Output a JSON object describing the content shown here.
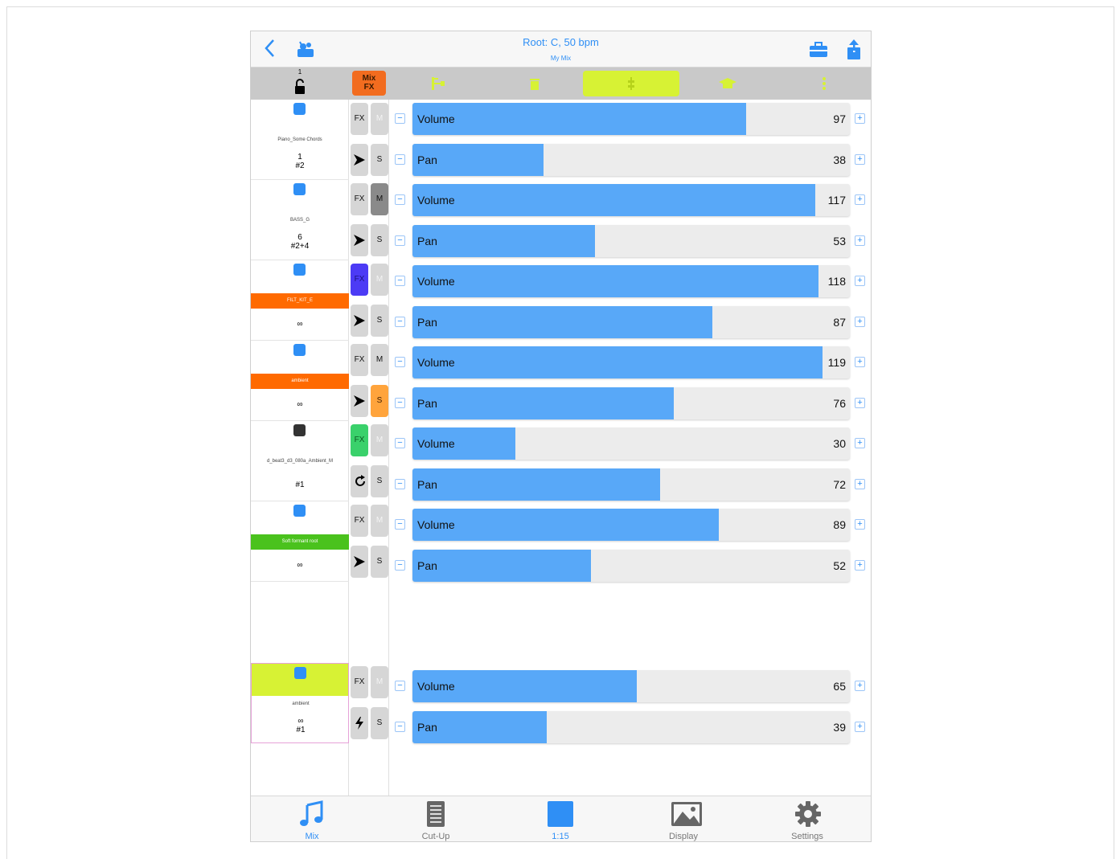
{
  "header": {
    "title": "Root: C, 50 bpm",
    "subtitle": "My Mix"
  },
  "toolbar": {
    "lock_number": "1",
    "mixfx_line1": "Mix",
    "mixfx_line2": "FX"
  },
  "tracks": [
    {
      "name": "Piano_Some Chords",
      "info1": "1",
      "info2": "#2",
      "icon": "note-icon"
    },
    {
      "name": "BASS_G",
      "info1": "6",
      "info2": "#2+4",
      "icon": "note-icon"
    },
    {
      "name": "FILT_KIT_E",
      "info1": "∞",
      "info2": "",
      "icon": "note-icon"
    },
    {
      "name": "ambient",
      "info1": "∞",
      "info2": "",
      "icon": "note-icon"
    },
    {
      "name": "d_beat3_d3_080a_Ambient_M",
      "info1": "#1",
      "info2": "",
      "icon": "document-icon"
    },
    {
      "name": "Soft formant root",
      "info1": "∞",
      "info2": "",
      "icon": "note-icon"
    }
  ],
  "master_track": {
    "name": "ambient",
    "info1": "∞",
    "info2": "#1",
    "icon": "note-icon"
  },
  "buttons": {
    "fx": "FX",
    "mute": "M",
    "solo": "S"
  },
  "params": [
    {
      "label": "Volume",
      "value": "97",
      "fraction": 0.762
    },
    {
      "label": "Pan",
      "value": "38",
      "fraction": 0.299
    },
    {
      "label": "Volume",
      "value": "117",
      "fraction": 0.921
    },
    {
      "label": "Pan",
      "value": "53",
      "fraction": 0.417
    },
    {
      "label": "Volume",
      "value": "118",
      "fraction": 0.929
    },
    {
      "label": "Pan",
      "value": "87",
      "fraction": 0.685
    },
    {
      "label": "Volume",
      "value": "119",
      "fraction": 0.937
    },
    {
      "label": "Pan",
      "value": "76",
      "fraction": 0.598
    },
    {
      "label": "Volume",
      "value": "30",
      "fraction": 0.236
    },
    {
      "label": "Pan",
      "value": "72",
      "fraction": 0.567
    },
    {
      "label": "Volume",
      "value": "89",
      "fraction": 0.701
    },
    {
      "label": "Pan",
      "value": "52",
      "fraction": 0.409
    },
    {
      "label": "Volume",
      "value": "65",
      "fraction": 0.512
    },
    {
      "label": "Pan",
      "value": "39",
      "fraction": 0.307
    }
  ],
  "tabs": [
    {
      "label": "Mix",
      "icon": "music-note-icon"
    },
    {
      "label": "Cut-Up",
      "icon": "document-icon"
    },
    {
      "label": "1:15",
      "icon": "square-icon"
    },
    {
      "label": "Display",
      "icon": "picture-icon"
    },
    {
      "label": "Settings",
      "icon": "gear-icon"
    }
  ],
  "colors": {
    "accent": "#2f8ff5",
    "fill": "#58a8f8",
    "highlight": "#d7f234",
    "mixfx": "#f26c1f"
  }
}
